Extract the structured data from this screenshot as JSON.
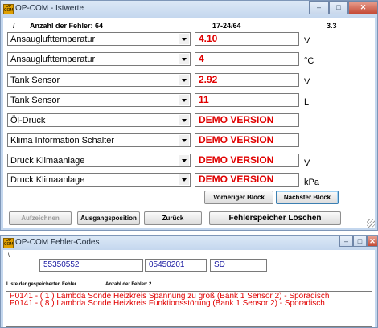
{
  "istwerte_window": {
    "title": "OP-COM - Istwerte",
    "header": {
      "slash": "/",
      "fehler_label": "Anzahl der Fehler: 64",
      "block_range": "17-24/64",
      "version": "3.3"
    },
    "rows": [
      {
        "param": "Ansauglufttemperatur",
        "value": "4.10",
        "unit": "V"
      },
      {
        "param": "Ansauglufttemperatur",
        "value": "4",
        "unit": "°C"
      },
      {
        "param": "Tank Sensor",
        "value": "2.92",
        "unit": "V"
      },
      {
        "param": "Tank Sensor",
        "value": "11",
        "unit": "L"
      },
      {
        "param": "Öl-Druck",
        "value": "DEMO VERSION",
        "unit": ""
      },
      {
        "param": "Klima Information Schalter",
        "value": "DEMO VERSION",
        "unit": ""
      },
      {
        "param": "Druck Klimaanlage",
        "value": "DEMO VERSION",
        "unit": "V"
      },
      {
        "param": "Druck Klimaanlage",
        "value": "DEMO VERSION",
        "unit": "kPa"
      }
    ],
    "buttons": {
      "prev_block": "Vorheriger Block",
      "next_block": "Nächster Block",
      "record": "Aufzeichnen",
      "start_position": "Ausgangsposition",
      "back": "Zurück",
      "clear_errors": "Fehlerspeicher Löschen"
    }
  },
  "fehler_window": {
    "title": "OP-COM Fehler-Codes",
    "small_mark": "\\",
    "field1": "55350552",
    "field2": "05450201",
    "field3": "SD",
    "list_label": "Liste der gespeicherten Fehler",
    "count_label": "Anzahl der Fehler: 2",
    "codes": [
      "P0141 - ( 1 )  Lambda Sonde Heizkreis Spannung zu groß (Bank 1 Sensor 2) - Sporadisch",
      "P0141 - ( 8 )  Lambda Sonde Heizkreis Funktionsstörung (Bank 1 Sensor 2) - Sporadisch"
    ]
  },
  "window_controls": {
    "minimize": "‒",
    "maximize": "□",
    "close": "✕"
  },
  "colors": {
    "value_red": "#e00000",
    "field_blue": "#1a1aa0",
    "frame": "#c4d7ee"
  }
}
